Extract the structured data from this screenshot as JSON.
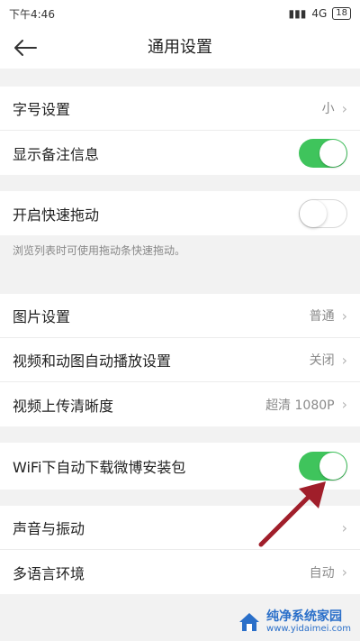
{
  "status": {
    "time": "下午4:46",
    "network": "4G",
    "battery": "18"
  },
  "header": {
    "title": "通用设置"
  },
  "section1": [
    {
      "label": "字号设置",
      "value": "小"
    },
    {
      "label": "显示备注信息",
      "toggle": "on"
    }
  ],
  "section2": {
    "label": "开启快速拖动",
    "toggle": "off",
    "hint": "浏览列表时可使用拖动条快速拖动。"
  },
  "section3": [
    {
      "label": "图片设置",
      "value": "普通"
    },
    {
      "label": "视频和动图自动播放设置",
      "value": "关闭"
    },
    {
      "label": "视频上传清晰度",
      "value": "超清 1080P"
    }
  ],
  "section4": {
    "label": "WiFi下自动下载微博安装包",
    "toggle": "on"
  },
  "section5": [
    {
      "label": "声音与振动",
      "value": ""
    },
    {
      "label": "多语言环境",
      "value": "自动"
    }
  ],
  "watermark": {
    "text": "纯净系统家园",
    "sub": "www.yidaimei.com"
  },
  "colors": {
    "toggle_on": "#3fc45c",
    "arrow": "#a01e2a",
    "background": "#f2f2f2"
  }
}
